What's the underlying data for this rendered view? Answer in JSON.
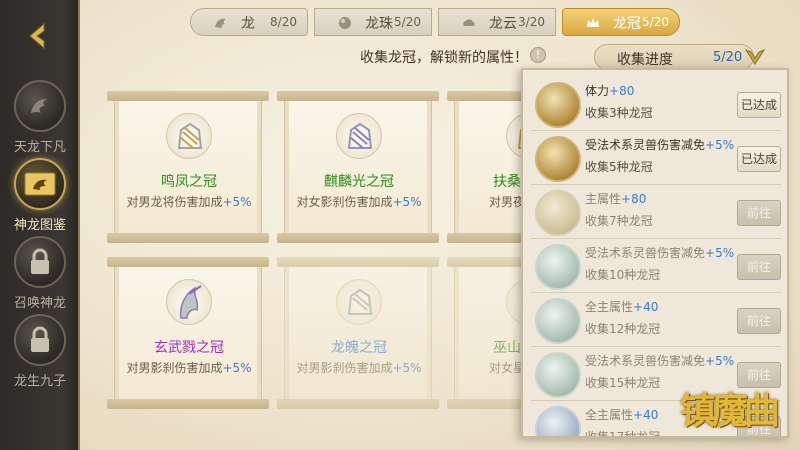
{
  "sidebar": {
    "back_icon": "back-arrow-icon",
    "items": [
      {
        "label": "天龙下凡",
        "icon": "dragon-icon",
        "active": false
      },
      {
        "label": "神龙图鉴",
        "icon": "dragon-book-icon",
        "active": true
      },
      {
        "label": "召唤神龙",
        "icon": "locked-icon",
        "active": false
      },
      {
        "label": "龙生九子",
        "icon": "locked-icon",
        "active": false
      }
    ]
  },
  "tabs": [
    {
      "label": "龙",
      "count": "8/20",
      "icon": "dragon-icon"
    },
    {
      "label": "龙珠",
      "count": "5/20",
      "icon": "pearl-icon"
    },
    {
      "label": "龙云",
      "count": "3/20",
      "icon": "cloud-icon"
    },
    {
      "label": "龙冠",
      "count": "5/20",
      "icon": "crown-icon",
      "active": true
    }
  ],
  "hint": "收集龙冠，解锁新的属性！",
  "progress": {
    "label": "收集进度",
    "count": "5/20"
  },
  "cards": [
    {
      "name": "鸣凤之冠",
      "desc": "对男龙将伤害加成",
      "bonus": "+5%",
      "name_color": "#2f8a1e"
    },
    {
      "name": "麒麟光之冠",
      "desc": "对女影刹伤害加成",
      "bonus": "+5%",
      "name_color": "#2f8a1e"
    },
    {
      "name": "扶桑",
      "desc": "对男夜狩伤",
      "bonus": "",
      "name_color": "#2f8a1e"
    },
    {
      "name": "玄武戮之冠",
      "desc": "对男影刹伤害加成",
      "bonus": "+5%",
      "name_color": "#9a2fc4"
    },
    {
      "name": "龙魄之冠",
      "desc": "对男影刹伤害加成",
      "bonus": "+5%",
      "name_color": "#3b7bc4"
    },
    {
      "name": "巫山",
      "desc": "对女星术伤",
      "bonus": "",
      "name_color": "#2f8a1e"
    }
  ],
  "rewards": [
    {
      "title": "体力",
      "plus": "+80",
      "sub": "收集3种龙冠",
      "button": "已达成",
      "state": "done"
    },
    {
      "title": "受法术系灵兽伤害减免",
      "plus": "+5%",
      "sub": "收集5种龙冠",
      "button": "已达成",
      "state": "done"
    },
    {
      "title": "主属性",
      "plus": "+80",
      "sub": "收集7种龙冠",
      "button": "前往",
      "state": "todo"
    },
    {
      "title": "受法术系灵兽伤害减免",
      "plus": "+5%",
      "sub": "收集10种龙冠",
      "button": "前往",
      "state": "todo"
    },
    {
      "title": "全主属性",
      "plus": "+40",
      "sub": "收集12种龙冠",
      "button": "前往",
      "state": "todo"
    },
    {
      "title": "受法术系灵兽伤害减免",
      "plus": "+5%",
      "sub": "收集15种龙冠",
      "button": "前往",
      "state": "todo"
    },
    {
      "title": "全主属性",
      "plus": "+40",
      "sub": "收集17种龙冠",
      "button": "前往",
      "state": "todo"
    }
  ],
  "logo": "镇魔曲"
}
